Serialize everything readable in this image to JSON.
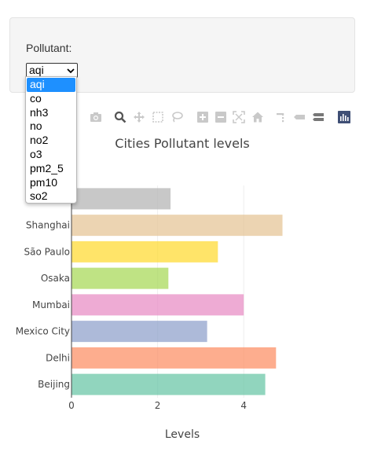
{
  "control": {
    "label": "Pollutant:",
    "selected": "aqi",
    "options": [
      "aqi",
      "co",
      "nh3",
      "no",
      "no2",
      "o3",
      "pm2_5",
      "pm10",
      "so2"
    ]
  },
  "modebar": {
    "icons": [
      "camera-icon",
      "zoom-icon",
      "pan-icon",
      "box-select-icon",
      "lasso-icon",
      "zoom-in-icon",
      "zoom-out-icon",
      "autoscale-icon",
      "home-icon",
      "spike-lines-icon",
      "hover-closest-icon",
      "hover-compare-icon",
      "plotly-logo-icon"
    ]
  },
  "chart_data": {
    "type": "bar",
    "orientation": "horizontal",
    "title": "Cities Pollutant levels",
    "xlabel": "Levels",
    "ylabel": "",
    "xlim": [
      0,
      5
    ],
    "xticks": [
      0,
      2,
      4
    ],
    "categories": [
      "Beijing",
      "Delhi",
      "Mexico City",
      "Mumbai",
      "Osaka",
      "São Paulo",
      "Shanghai",
      ""
    ],
    "values": [
      4.5,
      4.75,
      3.15,
      4.0,
      2.25,
      3.4,
      4.9,
      2.3
    ],
    "colors": [
      "#66c5a5",
      "#fc8d62",
      "#8da0cb",
      "#e78ac3",
      "#a6d854",
      "#ffd92f",
      "#e5c494",
      "#b3b3b3"
    ],
    "grid": true,
    "legend": "none"
  }
}
